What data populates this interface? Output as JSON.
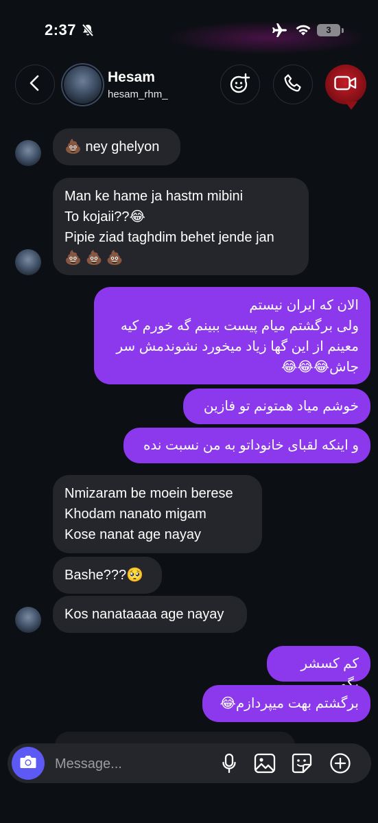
{
  "status_bar": {
    "time": "2:37",
    "battery": "3"
  },
  "header": {
    "name": "Hesam",
    "handle": "hesam_rhm_"
  },
  "messages": [
    {
      "side": "in",
      "text": "💩 ney ghelyon"
    },
    {
      "side": "in",
      "text": "Man ke hame ja hastm mibini\nTo kojaii??😂\nPipie ziad taghdim behet jende jan\n💩 💩 💩"
    },
    {
      "side": "out",
      "text": "الان که ایران نیستم\nولی برگشتم میام پیست ببینم گه خورم کیه\nمعینم از این گها زیاد میخورد نشوندمش سر جاش😂😂😂"
    },
    {
      "side": "out",
      "text": "خوشم میاد همتونم تو فازین"
    },
    {
      "side": "out",
      "text": "و اینکه لقبای خانوداتو به من نسبت نده"
    },
    {
      "side": "in",
      "text": "Nmizaram be moein berese\nKhodam nanato migam\nKose nanat age nayay"
    },
    {
      "side": "in",
      "text": "Bashe???🥺"
    },
    {
      "side": "in",
      "text": "Kos nanataaaa age nayay"
    },
    {
      "side": "out",
      "text": "کم کسشر بگو"
    },
    {
      "side": "out",
      "text": "برگشتم بهت میپردازم😂"
    }
  ],
  "composer": {
    "placeholder": "Message..."
  },
  "colors": {
    "background": "#0c0f14",
    "incoming_bubble": "#24262b",
    "outgoing_bubble": "#8c39ee",
    "camera_button": "#5d59f5",
    "video_button": "#c41d28"
  },
  "icons": [
    "bell-slash-icon",
    "airplane-icon",
    "wifi-icon",
    "back-chevron-icon",
    "effects-icon",
    "phone-icon",
    "video-camera-icon",
    "camera-icon",
    "microphone-icon",
    "gallery-icon",
    "sticker-icon",
    "plus-icon"
  ]
}
